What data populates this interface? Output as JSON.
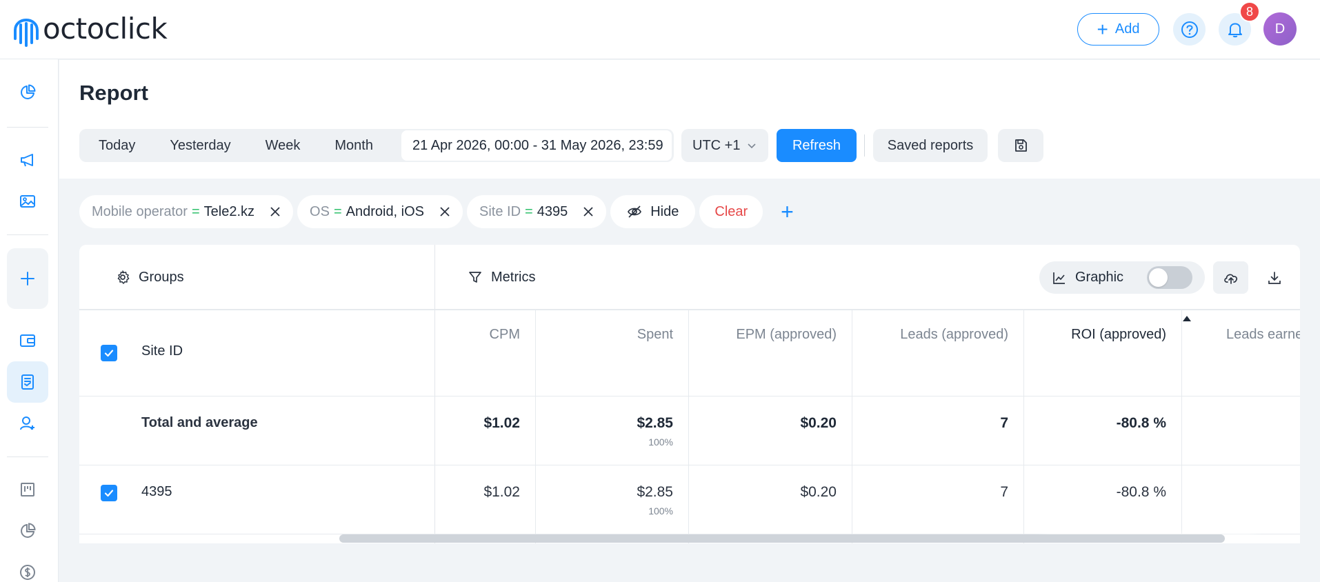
{
  "header": {
    "brand": "octoclick",
    "add_label": "Add",
    "notification_count": "8",
    "avatar_initial": "D"
  },
  "page": {
    "title": "Report"
  },
  "period": {
    "options": [
      "Today",
      "Yesterday",
      "Week",
      "Month"
    ],
    "date_range": "21 Apr 2026, 00:00 - 31 May 2026, 23:59",
    "timezone": "UTC +1",
    "refresh_label": "Refresh",
    "saved_reports_label": "Saved reports"
  },
  "filters": [
    {
      "key": "Mobile operator",
      "op": "=",
      "value": "Tele2.kz"
    },
    {
      "key": "OS",
      "op": "=",
      "value": "Android, iOS"
    },
    {
      "key": "Site ID",
      "op": "=",
      "value": "4395"
    }
  ],
  "filter_actions": {
    "hide_label": "Hide",
    "clear_label": "Clear",
    "add_symbol": "+"
  },
  "toolbar": {
    "groups_label": "Groups",
    "metrics_label": "Metrics",
    "graphic_label": "Graphic",
    "graphic_enabled": false
  },
  "table": {
    "group_column": "Site ID",
    "columns": [
      "CPM",
      "Spent",
      "EPM (approved)",
      "Leads (approved)",
      "ROI (approved)",
      "Leads earne"
    ],
    "sorted_column": "ROI (approved)",
    "total": {
      "label": "Total and average",
      "cpm": "$1.02",
      "spent": "$2.85",
      "spent_share": "100%",
      "epm": "$0.20",
      "leads": "7",
      "roi": "-80.8 %"
    },
    "rows": [
      {
        "site_id": "4395",
        "checked": true,
        "cpm": "$1.02",
        "spent": "$2.85",
        "spent_share": "100%",
        "epm": "$0.20",
        "leads": "7",
        "roi": "-80.8 %"
      }
    ]
  },
  "colors": {
    "accent": "#1a8cff",
    "danger": "#e64848",
    "operator_green": "#2ec06b",
    "badge_red": "#f04848"
  },
  "icons": {
    "sidebar": [
      "pie-chart-icon",
      "megaphone-icon",
      "image-icon",
      "plus-icon",
      "wallet-icon",
      "report-icon",
      "user-add-icon",
      "kanban-icon",
      "pie-chart-icon",
      "dollar-icon"
    ]
  }
}
